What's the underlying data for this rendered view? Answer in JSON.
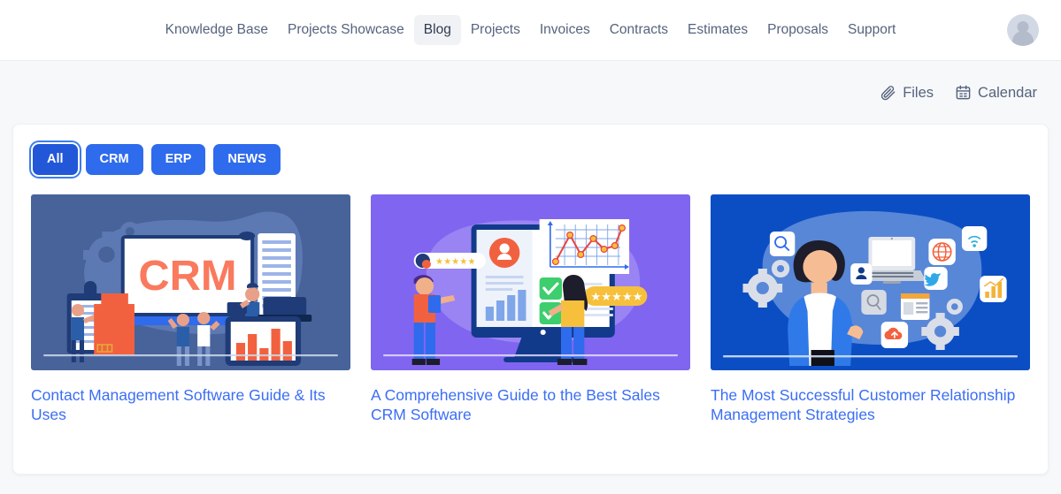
{
  "nav": {
    "items": [
      {
        "label": "Knowledge Base",
        "active": false
      },
      {
        "label": "Projects Showcase",
        "active": false
      },
      {
        "label": "Blog",
        "active": true
      },
      {
        "label": "Projects",
        "active": false
      },
      {
        "label": "Invoices",
        "active": false
      },
      {
        "label": "Contracts",
        "active": false
      },
      {
        "label": "Estimates",
        "active": false
      },
      {
        "label": "Proposals",
        "active": false
      },
      {
        "label": "Support",
        "active": false
      }
    ],
    "avatar_name": "user-avatar"
  },
  "actions": [
    {
      "label": "Files",
      "icon": "paperclip-icon"
    },
    {
      "label": "Calendar",
      "icon": "calendar-icon"
    }
  ],
  "filters": [
    {
      "label": "All",
      "selected": true
    },
    {
      "label": "CRM",
      "selected": false
    },
    {
      "label": "ERP",
      "selected": false
    },
    {
      "label": "NEWS",
      "selected": false
    }
  ],
  "posts": [
    {
      "title": "Contact Management Software Guide & Its Uses",
      "image": "crm-monitor-illustration"
    },
    {
      "title": "A Comprehensive Guide to the Best Sales CRM Software",
      "image": "sales-dashboard-illustration"
    },
    {
      "title": "The Most Successful Customer Relationship Management Strategies",
      "image": "customer-relationship-illustration"
    }
  ],
  "colors": {
    "accent": "#2f6bed",
    "accent_selected": "#2257d8",
    "link": "#3b6ef5",
    "nav_text": "#55637d",
    "page_bg": "#f7f8fa",
    "card_bg": "#ffffff",
    "thumb1_bg": "#47639a",
    "thumb2_bg": "#8065f0",
    "thumb3_bg": "#0b4ec4"
  }
}
